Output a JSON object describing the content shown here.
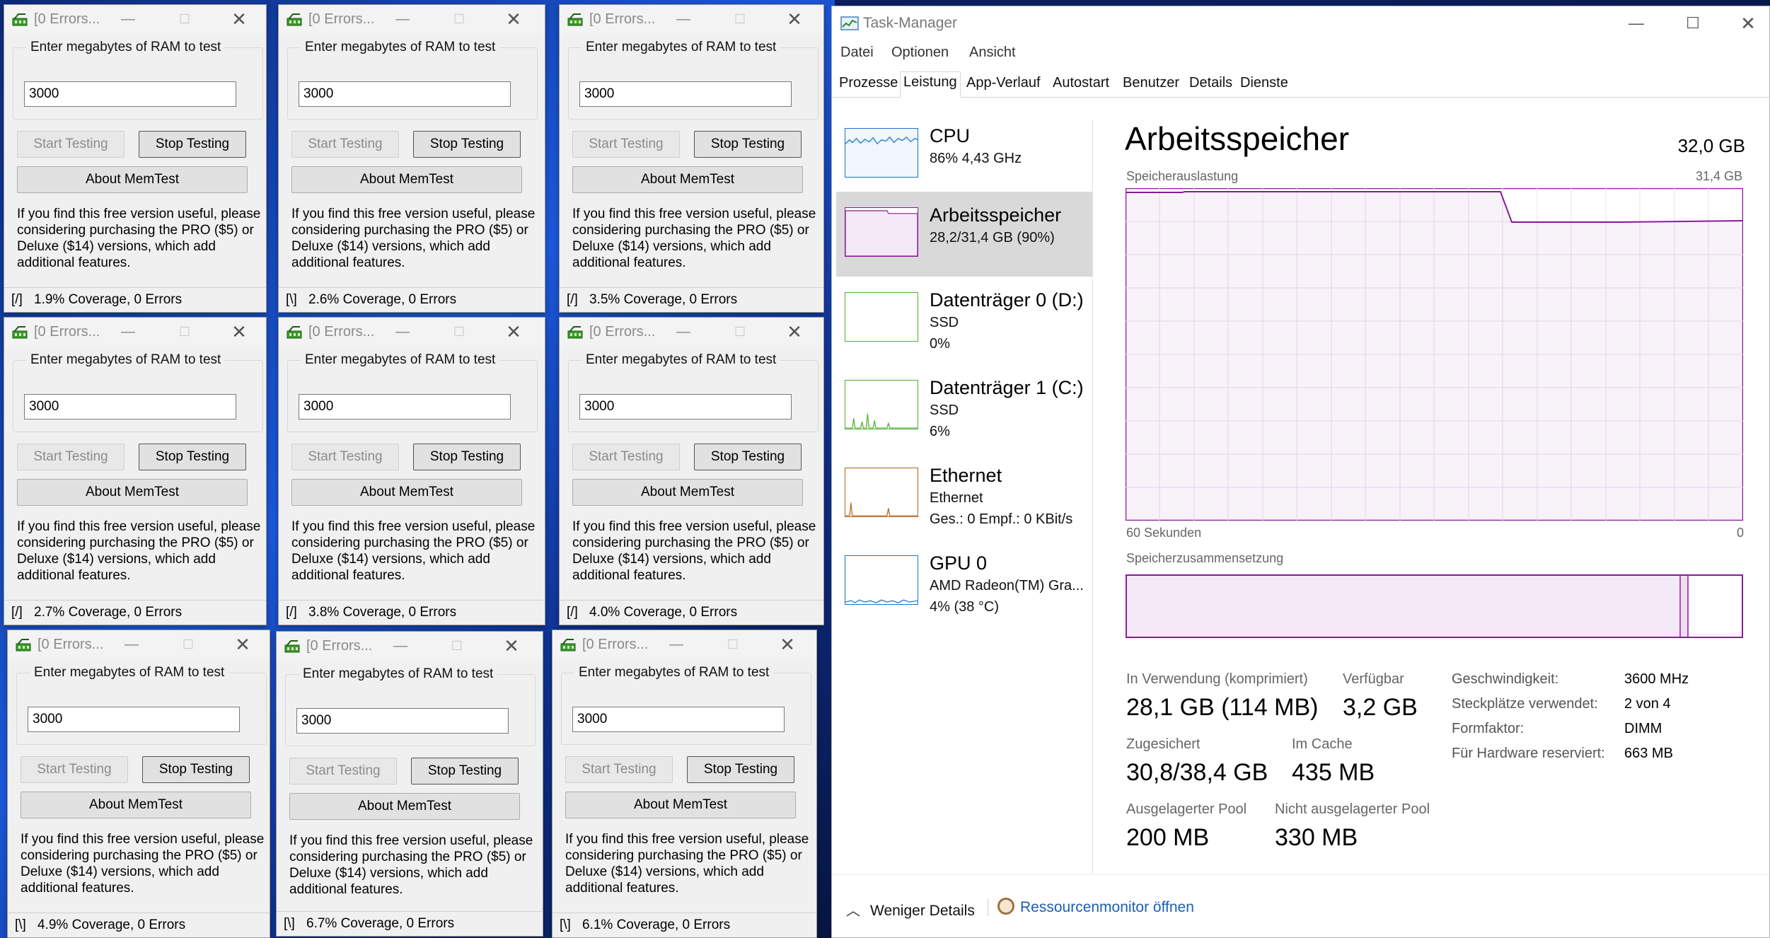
{
  "memtest": {
    "title": "[0 Errors...",
    "group_label": "Enter megabytes of RAM to test",
    "start_label": "Start Testing",
    "stop_label": "Stop Testing",
    "about_label": "About MemTest",
    "info_text": "If you find this free version useful, please considering purchasing the PRO ($5) or Deluxe ($14) versions, which add additional features.",
    "windows": [
      {
        "value": "3000",
        "spinner": "[/]",
        "status": "1.9% Coverage, 0 Errors"
      },
      {
        "value": "3000",
        "spinner": "[\\]",
        "status": "2.6% Coverage, 0 Errors"
      },
      {
        "value": "3000",
        "spinner": "[/]",
        "status": "3.5% Coverage, 0 Errors"
      },
      {
        "value": "3000",
        "spinner": "[/]",
        "status": "2.7% Coverage, 0 Errors"
      },
      {
        "value": "3000",
        "spinner": "[/]",
        "status": "3.8% Coverage, 0 Errors"
      },
      {
        "value": "3000",
        "spinner": "[/]",
        "status": "4.0% Coverage, 0 Errors"
      },
      {
        "value": "3000",
        "spinner": "[\\]",
        "status": "4.9% Coverage, 0 Errors"
      },
      {
        "value": "3000",
        "spinner": "[\\]",
        "status": "6.7% Coverage, 0 Errors"
      },
      {
        "value": "3000",
        "spinner": "[\\]",
        "status": "6.1% Coverage, 0 Errors"
      }
    ]
  },
  "taskmanager": {
    "title": "Task-Manager",
    "menu": [
      "Datei",
      "Optionen",
      "Ansicht"
    ],
    "tabs": [
      "Prozesse",
      "Leistung",
      "App-Verlauf",
      "Autostart",
      "Benutzer",
      "Details",
      "Dienste"
    ],
    "active_tab": "Leistung",
    "sidebar": [
      {
        "name": "CPU",
        "sub1": "86% 4,43 GHz",
        "sub2": "",
        "color": "#1a73c8"
      },
      {
        "name": "Arbeitsspeicher",
        "sub1": "28,2/31,4 GB (90%)",
        "sub2": "",
        "color": "#8b1a9c"
      },
      {
        "name": "Datenträger 0 (D:)",
        "sub1": "SSD",
        "sub2": "0%",
        "color": "#4caf30"
      },
      {
        "name": "Datenträger 1 (C:)",
        "sub1": "SSD",
        "sub2": "6%",
        "color": "#4caf30"
      },
      {
        "name": "Ethernet",
        "sub1": "Ethernet",
        "sub2": "Ges.: 0  Empf.: 0 KBit/s",
        "color": "#b0651d"
      },
      {
        "name": "GPU 0",
        "sub1": "AMD Radeon(TM) Gra...",
        "sub2": "4% (38 °C)",
        "color": "#1a73c8"
      }
    ],
    "main": {
      "title": "Arbeitsspeicher",
      "capacity": "32,0 GB",
      "usage_label": "Speicherauslastung",
      "usage_max": "31,4 GB",
      "time_left": "60 Sekunden",
      "time_right": "0",
      "composition_label": "Speicherzusammensetzung",
      "stats": {
        "in_use_label": "In Verwendung (komprimiert)",
        "in_use_value": "28,1 GB (114 MB)",
        "available_label": "Verfügbar",
        "available_value": "3,2 GB",
        "committed_label": "Zugesichert",
        "committed_value": "30,8/38,4 GB",
        "cached_label": "Im Cache",
        "cached_value": "435 MB",
        "paged_label": "Ausgelagerter Pool",
        "paged_value": "200 MB",
        "nonpaged_label": "Nicht ausgelagerter Pool",
        "nonpaged_value": "330 MB"
      },
      "specs": [
        {
          "label": "Geschwindigkeit:",
          "value": "3600 MHz"
        },
        {
          "label": "Steckplätze verwendet:",
          "value": "2 von 4"
        },
        {
          "label": "Formfaktor:",
          "value": "DIMM"
        },
        {
          "label": "Für Hardware reserviert:",
          "value": "663 MB"
        }
      ]
    },
    "footer": {
      "fewer_details": "Weniger Details",
      "resmon_link": "Ressourcenmonitor öffnen"
    },
    "accent_color": "#8b1a9c"
  }
}
